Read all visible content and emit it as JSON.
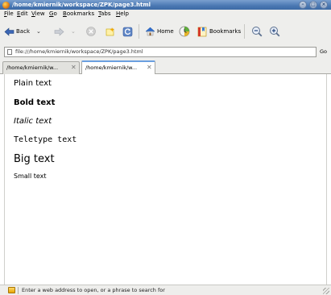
{
  "window": {
    "title": "/home/kmiernik/workspace/ZPK/page3.html",
    "controls": [
      "minimize",
      "maximize",
      "close"
    ]
  },
  "menubar": {
    "items": [
      {
        "label": "File",
        "mnemonic": "F",
        "rest": "ile"
      },
      {
        "label": "Edit",
        "mnemonic": "E",
        "rest": "dit"
      },
      {
        "label": "View",
        "mnemonic": "V",
        "rest": "iew"
      },
      {
        "label": "Go",
        "mnemonic": "G",
        "rest": "o"
      },
      {
        "label": "Bookmarks",
        "mnemonic": "B",
        "rest": "ookmarks"
      },
      {
        "label": "Tabs",
        "mnemonic": "T",
        "rest": "abs"
      },
      {
        "label": "Help",
        "mnemonic": "H",
        "rest": "elp"
      }
    ]
  },
  "toolbar": {
    "back_label": "Back",
    "home_label": "Home",
    "bookmarks_label": "Bookmarks",
    "colors": {
      "back_arrow": "#3b66b5",
      "stop": "#c8c8c8",
      "home_roof": "#2f6fd0"
    }
  },
  "addressbar": {
    "url": "file:///home/kmiernik/workspace/ZPK/page3.html",
    "go_label": "Go"
  },
  "tabs": [
    {
      "label": "/home/kmiernik/w...",
      "active": false
    },
    {
      "label": "/home/kmiernik/w...",
      "active": true
    }
  ],
  "content": {
    "plain": "Plain text",
    "bold": "Bold text",
    "italic": "Italic text",
    "teletype": "Teletype text",
    "big": "Big text",
    "small": "Small text"
  },
  "statusbar": {
    "text": "Enter a web address to open, or a phrase to search for"
  }
}
